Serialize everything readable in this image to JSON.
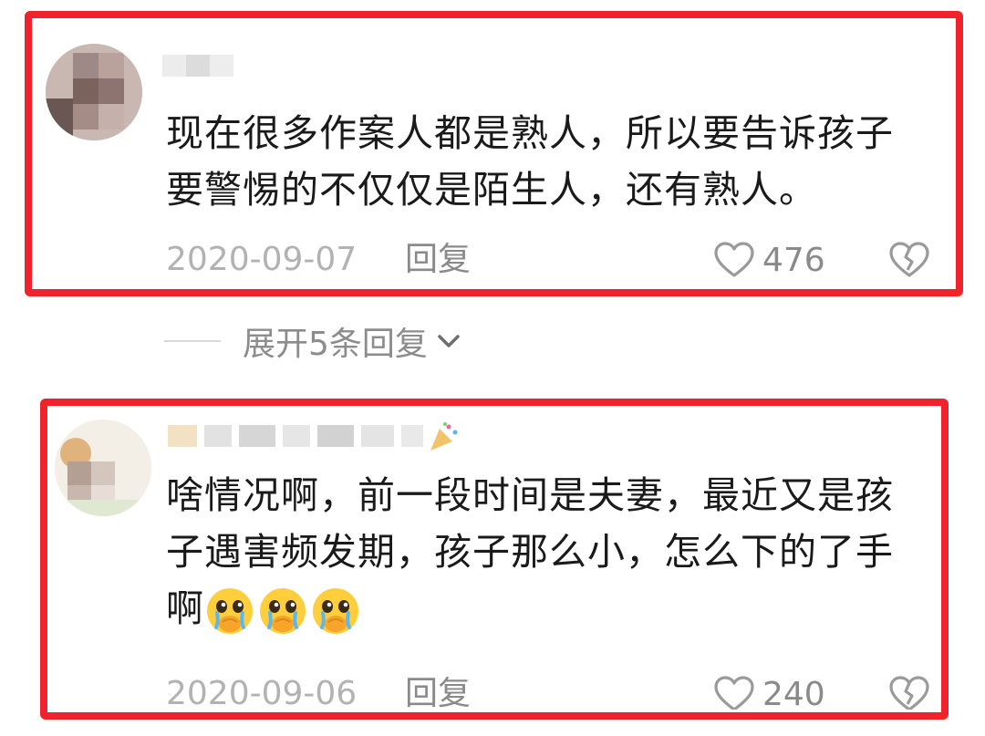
{
  "comments": [
    {
      "text": "现在很多作案人都是熟人，所以要告诉孩子要警惕的不仅仅是陌生人，还有熟人。",
      "date": "2020-09-07",
      "reply_label": "回复",
      "likes": "476"
    },
    {
      "text": "啥情况啊，前一段时间是夫妻，最近又是孩子遇害频发期，孩子那么小，怎么下的了手啊",
      "emoji": "pleading-face-emoji",
      "date": "2020-09-06",
      "reply_label": "回复",
      "likes": "240"
    }
  ],
  "expand_replies": {
    "label": "展开5条回复"
  },
  "colors": {
    "highlight_frame": "#f0232c",
    "meta_gray": "#b2b2b2",
    "text": "#1a1a1a"
  },
  "icons": {
    "like": "heart-outline-icon",
    "dislike": "broken-heart-icon",
    "expand": "chevron-down-icon"
  }
}
